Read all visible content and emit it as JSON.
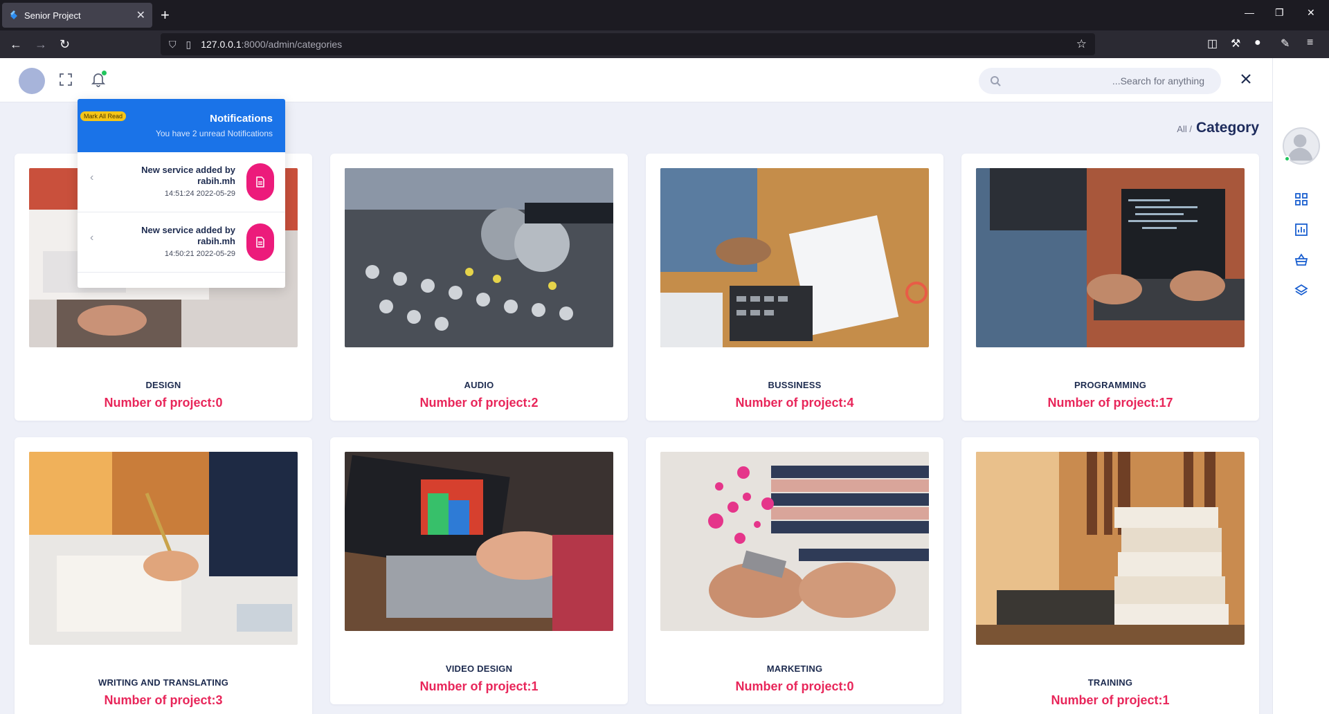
{
  "browser": {
    "tab_title": "Senior Project",
    "url_host": "127.0.0.1",
    "url_path": ":8000/admin/categories"
  },
  "header": {
    "search_placeholder": "...Search for anything"
  },
  "breadcrumb": {
    "all": "All /",
    "current": "Category"
  },
  "notifications": {
    "mark_all_read": "Mark All Read",
    "title": "Notifications",
    "subtitle": "You have 2 unread Notifications",
    "items": [
      {
        "text": "New service added by rabih.mh",
        "time": "14:51:24 2022-05-29"
      },
      {
        "text": "New service added by rabih.mh",
        "time": "14:50:21 2022-05-29"
      }
    ]
  },
  "categories": [
    {
      "name": "DESIGN",
      "count": "Number of project:0"
    },
    {
      "name": "AUDIO",
      "count": "Number of project:2"
    },
    {
      "name": "BUSSINESS",
      "count": "Number of project:4"
    },
    {
      "name": "PROGRAMMING",
      "count": "Number of project:17"
    },
    {
      "name": "WRITING AND TRANSLATING",
      "count": "Number of project:3"
    },
    {
      "name": "VIDEO DESIGN",
      "count": "Number of project:1"
    },
    {
      "name": "MARKETING",
      "count": "Number of project:0"
    },
    {
      "name": "TRAINING",
      "count": "Number of project:1"
    }
  ],
  "colors": {
    "accent": "#1a73e8",
    "count_text": "#e8265a",
    "notif_badge": "#ec1b7b"
  }
}
